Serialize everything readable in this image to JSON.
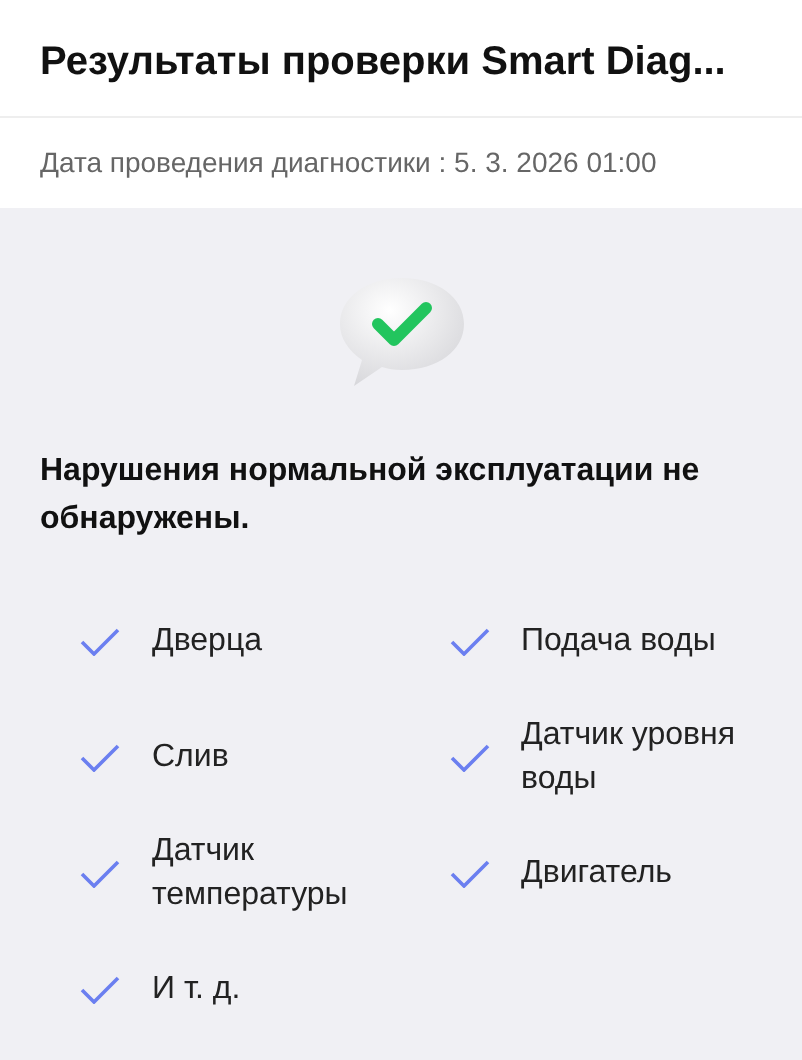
{
  "header": {
    "title": "Результаты проверки Smart Diag..."
  },
  "date_line": "Дата проведения диагностики : 5. 3. 2026 01:00",
  "result": {
    "message": "Нарушения нормальной эксплуатации не обнаружены."
  },
  "checks": [
    {
      "label": "Дверца",
      "checked": true
    },
    {
      "label": "Слив",
      "checked": true
    },
    {
      "label": "Датчик температуры",
      "checked": true
    },
    {
      "label": "И т. д.",
      "checked": true
    },
    {
      "label": "Подача воды",
      "checked": true
    },
    {
      "label": "Датчик уровня воды",
      "checked": true
    },
    {
      "label": "Двигатель",
      "checked": true
    }
  ]
}
